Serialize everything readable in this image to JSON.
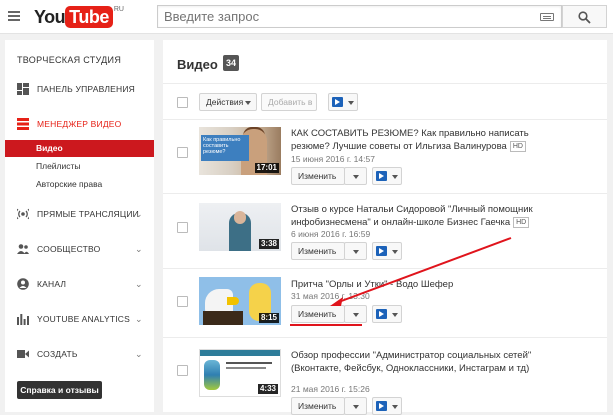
{
  "header": {
    "logo_you": "You",
    "logo_tube": "Tube",
    "logo_region": "RU",
    "search_placeholder": "Введите запрос"
  },
  "sidebar": {
    "studio_title": "ТВОРЧЕСКАЯ СТУДИЯ",
    "items": [
      {
        "label": "ПАНЕЛЬ УПРАВЛЕНИЯ",
        "icon": "dashboard-icon"
      },
      {
        "label": "МЕНЕДЖЕР ВИДЕО",
        "icon": "video-manager-icon",
        "active": true
      },
      {
        "label": "ПРЯМЫЕ ТРАНСЛЯЦИИ",
        "icon": "live-icon"
      },
      {
        "label": "СООБЩЕСТВО",
        "icon": "community-icon"
      },
      {
        "label": "КАНАЛ",
        "icon": "channel-icon"
      },
      {
        "label": "YOUTUBE ANALYTICS",
        "icon": "analytics-icon"
      },
      {
        "label": "СОЗДАТЬ",
        "icon": "create-icon"
      }
    ],
    "sub_items": [
      "Видео",
      "Плейлисты",
      "Авторские права"
    ],
    "help_button": "Справка и отзывы"
  },
  "main": {
    "title": "Видео",
    "count": "34",
    "toolbar": {
      "actions_label": "Действия",
      "add_to_label": "Добавить в"
    },
    "edit_label": "Изменить",
    "hd_badge": "HD",
    "videos": [
      {
        "title": "КАК СОСТАВИТЬ РЕЗЮМЕ? Как правильно написать резюме? Лучшие советы от Ильгиза Валинурова",
        "date": "15 июня 2016 г. 14:57",
        "duration": "17:01",
        "thumb_caption": "Как правильно составить резюме?",
        "hd": true
      },
      {
        "title": "Отзыв о курсе Натальи Сидоровой \"Личный помощник инфобизнесмена\" и онлайн-школе Бизнес Гаечка",
        "date": "6 июня 2016 г. 16:59",
        "duration": "3:38",
        "hd": true
      },
      {
        "title": "Притча \"Орлы и Утки\" - Водо Шефер",
        "date": "31 мая 2016 г. 13:30",
        "duration": "8:15",
        "hd": false
      },
      {
        "title": "Обзор профессии \"Администратор социальных сетей\" (Вконтакте, Фейсбук, Одноклассники, Инстаграм и тд)",
        "date": "21 мая 2016 г. 15:26",
        "duration": "4:33",
        "hd": false
      }
    ]
  },
  "colors": {
    "brand_red": "#e62117",
    "active_sub": "#cc181e",
    "annotation": "#e0141c"
  }
}
